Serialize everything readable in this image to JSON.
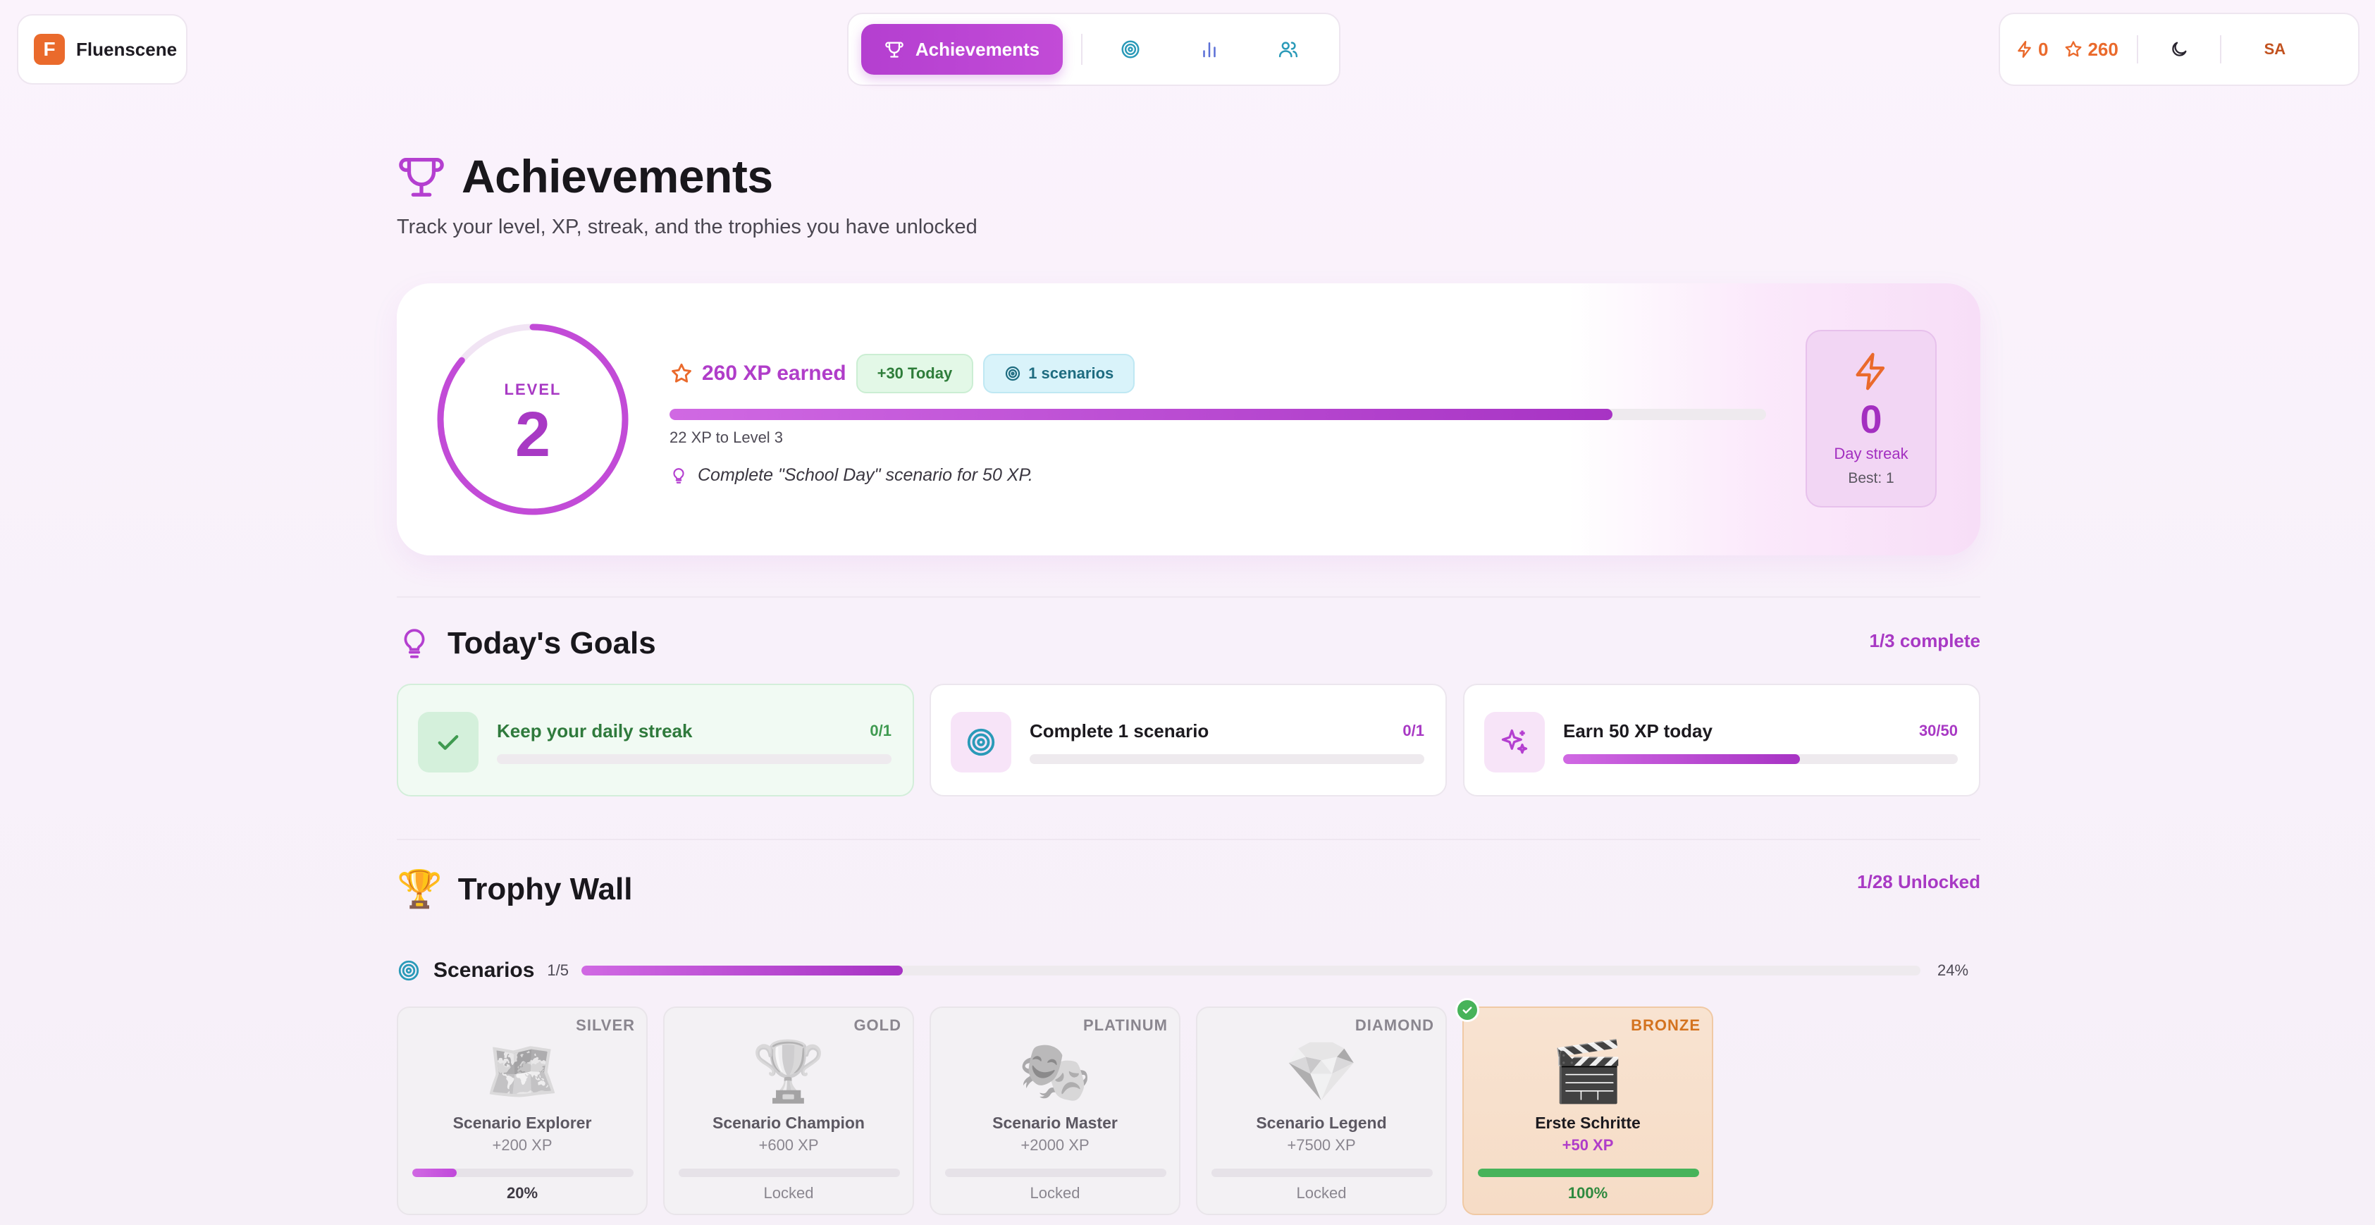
{
  "app": {
    "name": "Fluenscene",
    "logo_letter": "F"
  },
  "nav": {
    "active_label": "Achievements",
    "icons": [
      "target-icon",
      "bar-chart-icon",
      "users-icon"
    ]
  },
  "topbar": {
    "lightning_count": "0",
    "star_count": "260",
    "avatar_initials": "SA"
  },
  "header": {
    "title": "Achievements",
    "subtitle": "Track your level, XP, streak, and the trophies you have unlocked"
  },
  "level": {
    "label": "LEVEL",
    "value": "2",
    "ring_progress": 0.86,
    "xp_earned": "260 XP earned",
    "today_badge": "+30 Today",
    "scenarios_badge": "1 scenarios",
    "xp_progress": 0.86,
    "to_next": "22 XP to Level 3",
    "tip": "Complete \"School Day\" scenario for 50 XP."
  },
  "streak": {
    "value": "0",
    "label": "Day streak",
    "best": "Best: 1"
  },
  "goals": {
    "title": "Today's Goals",
    "summary": "1/3 complete",
    "items": [
      {
        "name": "Keep your daily streak",
        "count": "0/1",
        "progress": 0,
        "done": true
      },
      {
        "name": "Complete 1 scenario",
        "count": "0/1",
        "progress": 0,
        "done": false
      },
      {
        "name": "Earn 50 XP today",
        "count": "30/50",
        "progress": 0.6,
        "done": false
      }
    ]
  },
  "trophies": {
    "title": "Trophy Wall",
    "summary": "1/28 Unlocked",
    "category": {
      "name": "Scenarios",
      "count": "1/5",
      "progress": 0.24,
      "percent": "24%"
    },
    "items": [
      {
        "tier": "SILVER",
        "icon": "🗺️",
        "name": "Scenario Explorer",
        "xp": "+200 XP",
        "progress": 0.2,
        "status": "20%"
      },
      {
        "tier": "GOLD",
        "icon": "🏆",
        "name": "Scenario Champion",
        "xp": "+600 XP",
        "progress": 0,
        "status": "Locked"
      },
      {
        "tier": "PLATINUM",
        "icon": "🎭",
        "name": "Scenario Master",
        "xp": "+2000 XP",
        "progress": 0,
        "status": "Locked"
      },
      {
        "tier": "DIAMOND",
        "icon": "💎",
        "name": "Scenario Legend",
        "xp": "+7500 XP",
        "progress": 0,
        "status": "Locked"
      },
      {
        "tier": "BRONZE",
        "icon": "🎬",
        "name": "Erste Schritte",
        "xp": "+50 XP",
        "progress": 1,
        "status": "100%"
      }
    ]
  },
  "colors": {
    "accent": "#b43fd0",
    "orange": "#ea6a2c",
    "green": "#47b35a"
  }
}
